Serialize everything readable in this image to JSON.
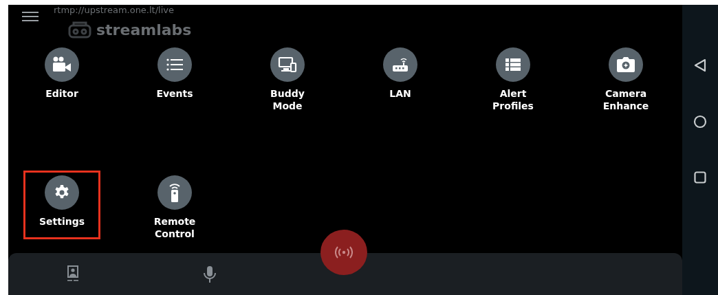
{
  "stream_url": "rtmp://upstream.one.lt/live",
  "logo": {
    "text": "streamlabs"
  },
  "menu_items": [
    {
      "label": "Editor",
      "kind": "camera",
      "highlighted": false
    },
    {
      "label": "Events",
      "kind": "list",
      "highlighted": false
    },
    {
      "label": "Buddy\nMode",
      "kind": "devices",
      "highlighted": false
    },
    {
      "label": "LAN",
      "kind": "router",
      "highlighted": false
    },
    {
      "label": "Alert\nProfiles",
      "kind": "table",
      "highlighted": false
    },
    {
      "label": "Camera\nEnhance",
      "kind": "photo",
      "highlighted": false
    },
    {
      "label": "Settings",
      "kind": "gear",
      "highlighted": true
    },
    {
      "label": "Remote\nControl",
      "kind": "remote",
      "highlighted": false
    }
  ]
}
